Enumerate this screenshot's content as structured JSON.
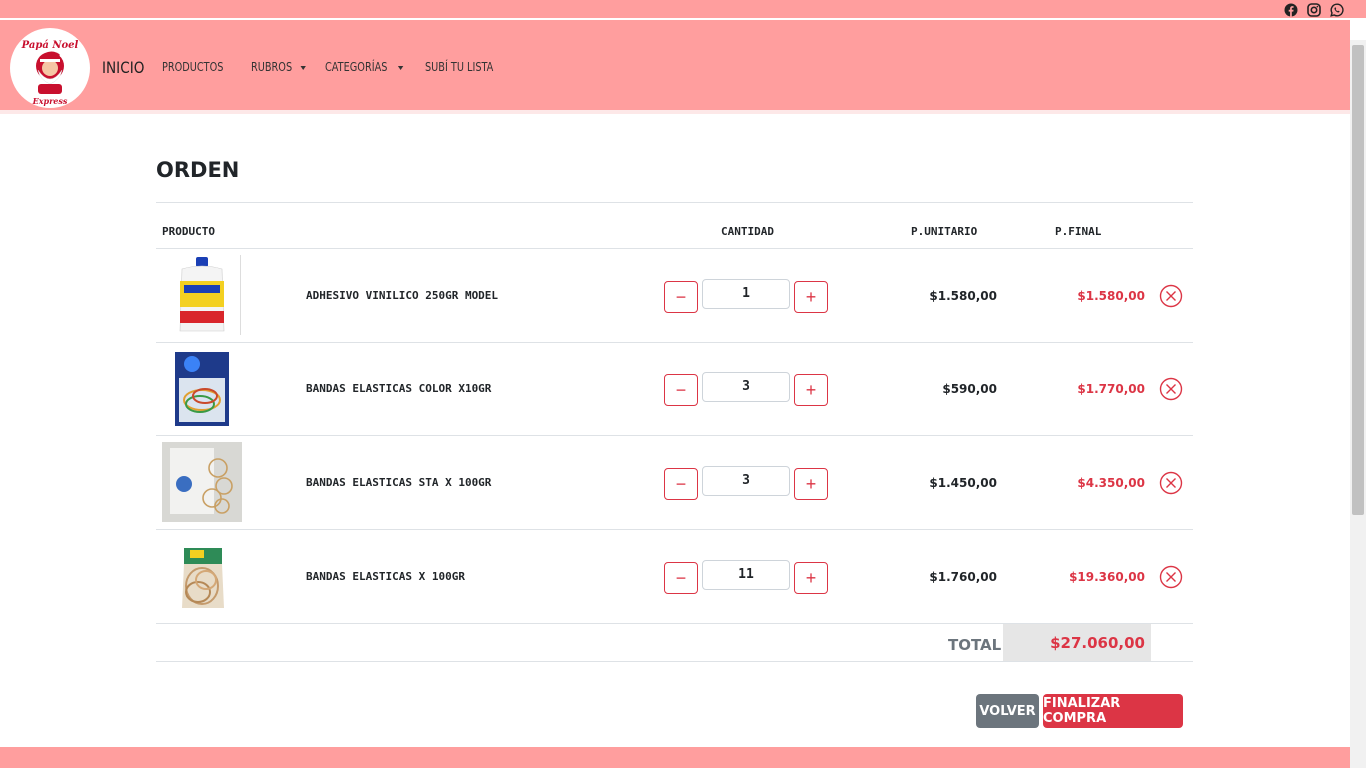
{
  "social": {
    "icons": [
      "facebook-icon",
      "instagram-icon",
      "whatsapp-icon"
    ]
  },
  "nav": {
    "brand": "INICIO",
    "links": [
      {
        "label": "PRODUCTOS"
      },
      {
        "label": "RUBROS"
      },
      {
        "label": "CATEGORÍAS"
      },
      {
        "label": "SUBÍ TU LISTA"
      }
    ]
  },
  "order": {
    "title": "ORDEN",
    "headers": {
      "product": "PRODUCTO",
      "quantity": "CANTIDAD",
      "unit": "P.UNITARIO",
      "final": "P.FINAL"
    },
    "items": [
      {
        "name": "ADHESIVO VINILICO 250GR MODEL",
        "qty": "1",
        "unit": "$1.580,00",
        "final": "$1.580,00"
      },
      {
        "name": "BANDAS ELASTICAS COLOR X10GR",
        "qty": "3",
        "unit": "$590,00",
        "final": "$1.770,00"
      },
      {
        "name": "BANDAS ELASTICAS STA X 100GR",
        "qty": "3",
        "unit": "$1.450,00",
        "final": "$4.350,00"
      },
      {
        "name": "BANDAS ELASTICAS X 100GR",
        "qty": "11",
        "unit": "$1.760,00",
        "final": "$19.360,00"
      }
    ],
    "total_label": "TOTAL",
    "total_value": "$27.060,00",
    "back_label": "VOLVER",
    "checkout_label": "FINALIZAR COMPRA"
  },
  "colors": {
    "header": "#ff9e9e",
    "accent": "#dc3545",
    "secondary": "#6c757d"
  }
}
